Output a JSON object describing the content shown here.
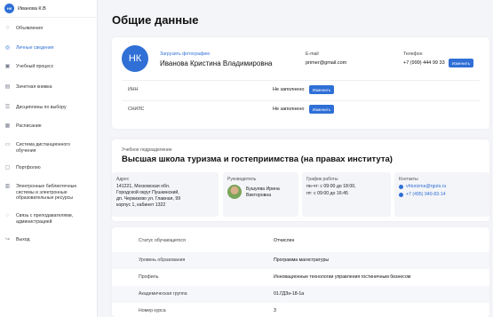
{
  "sidebar": {
    "avatar_initials": "НК",
    "user_name": "Иванова К.В",
    "items": [
      {
        "label": "Объявления",
        "icon": "bell-icon"
      },
      {
        "label": "Личные сведения",
        "icon": "user-icon"
      },
      {
        "label": "Учебный процесс",
        "icon": "graduation-cap-icon"
      },
      {
        "label": "Зачетная книжка",
        "icon": "book-icon"
      },
      {
        "label": "Дисциплины по выбору",
        "icon": "list-icon"
      },
      {
        "label": "Расписание",
        "icon": "calendar-icon"
      },
      {
        "label": "Система дистанционного обучения",
        "icon": "monitor-icon"
      },
      {
        "label": "Портфолио",
        "icon": "briefcase-icon"
      },
      {
        "label": "Электронные библиотечные системы и электронные образовательные ресурсы",
        "icon": "library-icon"
      },
      {
        "label": "Связь с преподавателями, администрацией",
        "icon": "chat-icon"
      },
      {
        "label": "Выход",
        "icon": "logout-icon"
      }
    ]
  },
  "main": {
    "title": "Общие данные",
    "profile": {
      "avatar_initials": "НК",
      "upload_label": "Загрузить фотографию",
      "full_name": "Иванова Кристина Владимировна",
      "email_label": "E-mail",
      "email_value": "primer@gmail.com",
      "phone_label": "Телефон",
      "phone_value": "+7 (999) 444 99 33",
      "phone_change": "Изменить",
      "inn_label": "ИНН",
      "inn_value": "Не заполнено",
      "inn_change": "Изменить",
      "snils_label": "СНИЛС",
      "snils_value": "Не заполнено",
      "snils_change": "Изменить"
    },
    "unit": {
      "caption": "Учебное подразделение",
      "name": "Высшая школа туризма и гостеприимства (на правах института)",
      "address_label": "Адрес",
      "address_lines": [
        "141221, Московская обл.",
        "Городской округ Пушкинский,",
        "дп. Черкизово ул. Главная, 99",
        "корпус 1, кабинет 1322"
      ],
      "head_label": "Руководитель",
      "head_lines": [
        "Бушуева Ирина",
        "Викторовна"
      ],
      "schedule_label": "График работы",
      "schedule_lines": [
        "пн-чт: с 09:00 до 18:00,",
        "пт: с 09:00 до 16:45"
      ],
      "contacts_label": "Контакты",
      "contact_email": "vhturizma@rguts.ru",
      "contact_phone": "+7 (495) 940-83-14"
    },
    "details": [
      {
        "label": "Статус обучающегося",
        "value": "Отчислен"
      },
      {
        "label": "Уровень образования",
        "value": "Программа магистратуры"
      },
      {
        "label": "Профиль",
        "value": "Инновационные технологии управления гостиничным бизнесом"
      },
      {
        "label": "Академическая группа",
        "value": "01.ГДЗн-18-1а"
      },
      {
        "label": "Номер курса",
        "value": "3"
      }
    ]
  },
  "colors": {
    "accent": "#2f6fd6",
    "background": "#f4f5f8"
  }
}
